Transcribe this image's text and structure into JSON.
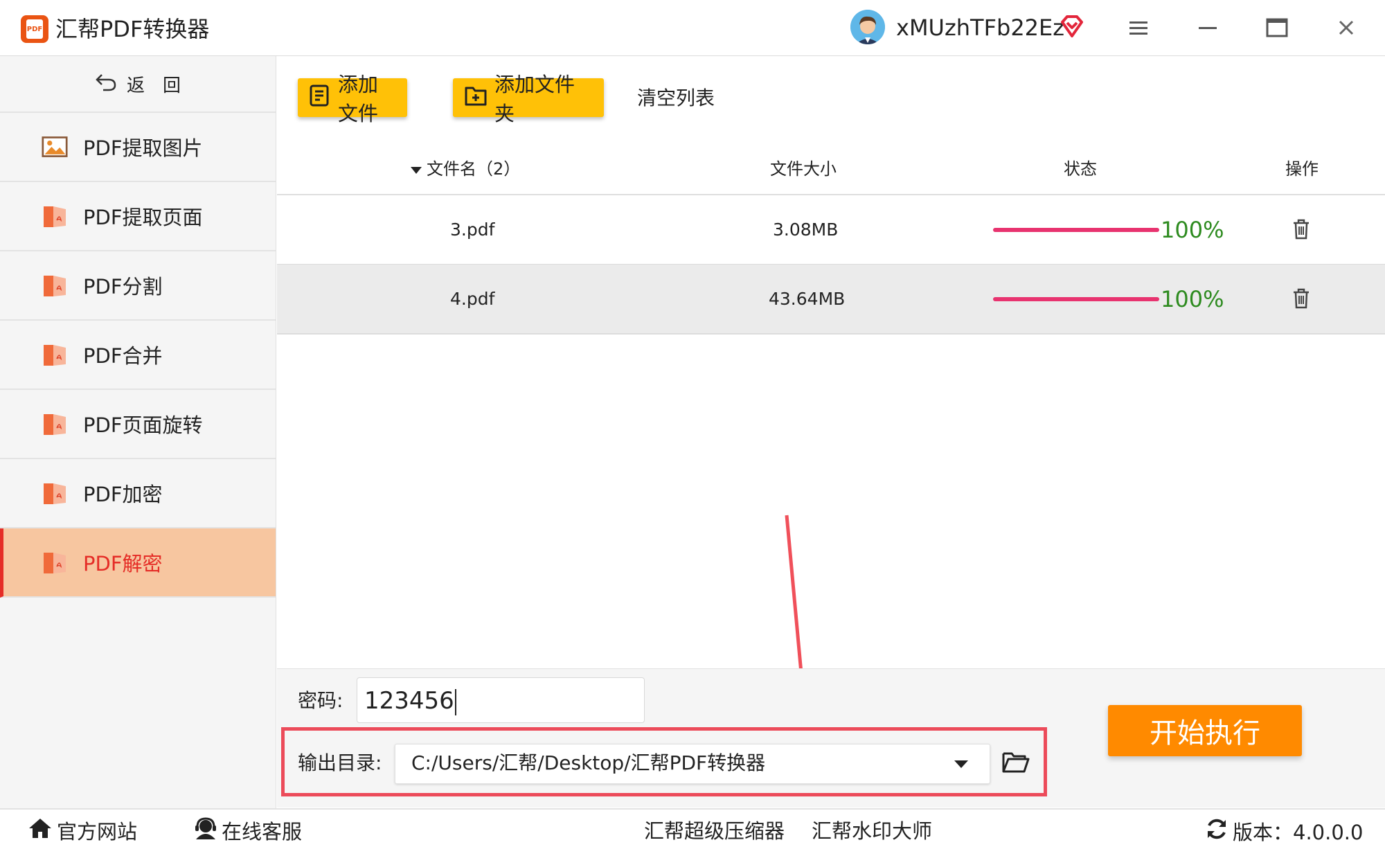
{
  "app": {
    "title": "汇帮PDF转换器",
    "logo_text": "PDF",
    "username": "xMUzhTFb22Ez"
  },
  "window_controls": [
    "menu-icon",
    "minimize-icon",
    "maximize-icon",
    "close-icon"
  ],
  "sidebar": {
    "back_label": "返　回",
    "items": [
      {
        "label": "PDF提取图片",
        "icon": "image-icon",
        "active": false
      },
      {
        "label": "PDF提取页面",
        "icon": "pdf-book-icon",
        "active": false
      },
      {
        "label": "PDF分割",
        "icon": "pdf-book-icon",
        "active": false
      },
      {
        "label": "PDF合并",
        "icon": "pdf-book-icon",
        "active": false
      },
      {
        "label": "PDF页面旋转",
        "icon": "pdf-book-icon",
        "active": false
      },
      {
        "label": "PDF加密",
        "icon": "pdf-book-icon",
        "active": false
      },
      {
        "label": "PDF解密",
        "icon": "pdf-book-icon",
        "active": true
      }
    ]
  },
  "toolbar": {
    "add_file": "添加文件",
    "add_folder": "添加文件夹",
    "clear_list": "清空列表"
  },
  "table": {
    "headers": {
      "name": "文件名（2）",
      "size": "文件大小",
      "status": "状态",
      "action": "操作"
    },
    "rows": [
      {
        "name": "3.pdf",
        "size": "3.08MB",
        "progress": "100%"
      },
      {
        "name": "4.pdf",
        "size": "43.64MB",
        "progress": "100%"
      }
    ]
  },
  "password": {
    "label": "密码:",
    "value": "123456"
  },
  "output": {
    "label": "输出目录:",
    "path": "C:/Users/汇帮/Desktop/汇帮PDF转换器"
  },
  "start_button": "开始执行",
  "footer": {
    "website": "官方网站",
    "support": "在线客服",
    "compressor": "汇帮超级压缩器",
    "watermark": "汇帮水印大师",
    "version": "版本：4.0.0.0"
  },
  "colors": {
    "accent_yellow": "#ffc107",
    "start_orange": "#ff8a00",
    "active_bg": "#f7c6a0",
    "active_text": "#e52d27",
    "progress": "#e8336f",
    "progress_text": "#2e8b20",
    "highlight": "#ec4b5a"
  }
}
